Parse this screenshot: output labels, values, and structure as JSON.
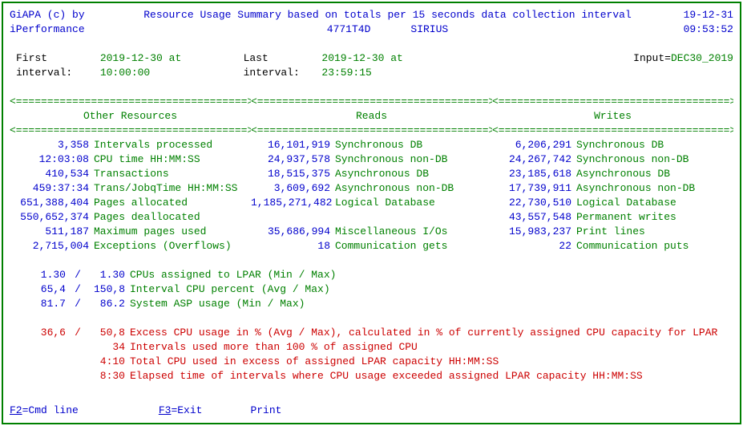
{
  "header": {
    "product": "GiAPA (c) by",
    "title": "Resource Usage Summary based on totals per 15 seconds data collection interval",
    "date": "19-12-31",
    "company": "iPerformance",
    "serial": "4771T4D",
    "system": "SIRIUS",
    "time": "09:53:52"
  },
  "intervals": {
    "first_label": "First interval: ",
    "first_value": "2019-12-30 at 10:00:00",
    "last_label": "Last interval: ",
    "last_value": "2019-12-30 at 23:59:15",
    "input_label": "Input=",
    "input_value": "DEC30_2019"
  },
  "sections": {
    "divider": "<=====================================>",
    "other": "Other Resources",
    "reads": "Reads",
    "writes": "Writes"
  },
  "other_resources": [
    {
      "value": "3,358",
      "label": "Intervals processed"
    },
    {
      "value": "12:03:08",
      "label": "CPU time HH:MM:SS"
    },
    {
      "value": "410,534",
      "label": "Transactions"
    },
    {
      "value": "459:37:34",
      "label": "Trans/JobqTime HH:MM:SS"
    },
    {
      "value": "651,388,404",
      "label": "Pages allocated"
    },
    {
      "value": "550,652,374",
      "label": "Pages deallocated"
    },
    {
      "value": "511,187",
      "label": "Maximum pages used"
    },
    {
      "value": "2,715,004",
      "label": "Exceptions (Overflows)"
    }
  ],
  "reads": [
    {
      "value": "16,101,919",
      "label": "Synchronous DB"
    },
    {
      "value": "24,937,578",
      "label": "Synchronous non-DB"
    },
    {
      "value": "18,515,375",
      "label": "Asynchronous DB"
    },
    {
      "value": "3,609,692",
      "label": "Asynchronous non-DB"
    },
    {
      "value": "1,185,271,482",
      "label": "Logical Database"
    },
    {
      "value": "",
      "label": ""
    },
    {
      "value": "35,686,994",
      "label": "Miscellaneous I/Os"
    },
    {
      "value": "18",
      "label": "Communication gets"
    }
  ],
  "writes": [
    {
      "value": "6,206,291",
      "label": "Synchronous DB"
    },
    {
      "value": "24,267,742",
      "label": "Synchronous non-DB"
    },
    {
      "value": "23,185,618",
      "label": "Asynchronous DB"
    },
    {
      "value": "17,739,911",
      "label": "Asynchronous non-DB"
    },
    {
      "value": "22,730,510",
      "label": "Logical Database"
    },
    {
      "value": "43,557,548",
      "label": "Permanent writes"
    },
    {
      "value": "15,983,237",
      "label": "Print lines"
    },
    {
      "value": "22",
      "label": "Communication puts"
    }
  ],
  "stats": [
    {
      "v1": "1.30",
      "slash": "/",
      "v2": "1.30",
      "label": "CPUs assigned to LPAR (Min / Max)"
    },
    {
      "v1": "65,4",
      "slash": "/",
      "v2": "150,8",
      "label": "Interval CPU percent  (Avg / Max)"
    },
    {
      "v1": "81.7",
      "slash": "/",
      "v2": "86.2",
      "label": "System ASP usage      (Min / Max)"
    }
  ],
  "red_stats": {
    "excess": {
      "v1": "36,6",
      "slash": "/",
      "v2": "50,8",
      "label": "Excess CPU usage in % (Avg / Max), calculated in % of currently assigned CPU capacity for LPAR"
    },
    "intervals_over": {
      "value": "34",
      "label": "Intervals used more than 100 % of assigned CPU"
    },
    "total_cpu_excess": {
      "value": "4:10",
      "label": "Total CPU used in excess of assigned LPAR capacity HH:MM:SS"
    },
    "elapsed_time": {
      "value": "8:30",
      "label": "Elapsed time of intervals where CPU usage exceeded assigned LPAR capacity HH:MM:SS"
    }
  },
  "footer": {
    "f2": "=Cmd line",
    "f3": "=Exit",
    "print": "Print"
  }
}
